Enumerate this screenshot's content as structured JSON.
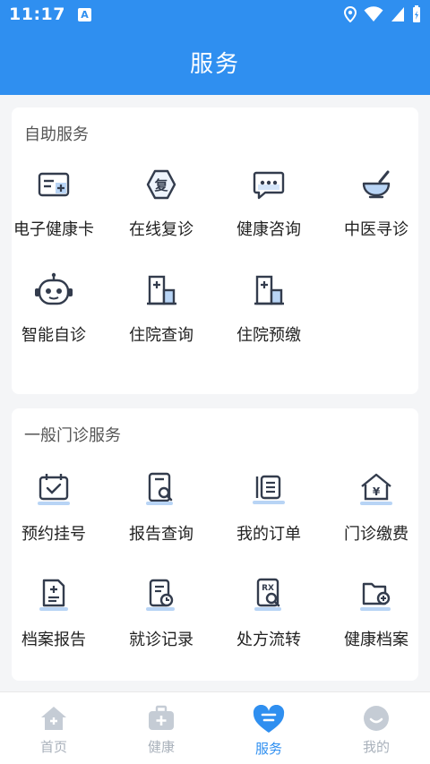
{
  "status_bar": {
    "time": "11:17",
    "notification_badge": "A"
  },
  "header": {
    "title": "服务"
  },
  "sections": [
    {
      "title": "自助服务",
      "items": [
        {
          "label": "电子健康卡",
          "icon": "health-card-icon"
        },
        {
          "label": "在线复诊",
          "icon": "revisit-icon",
          "glyph": "复"
        },
        {
          "label": "健康咨询",
          "icon": "chat-icon"
        },
        {
          "label": "中医寻诊",
          "icon": "mortar-icon"
        },
        {
          "label": "智能自诊",
          "icon": "robot-icon"
        },
        {
          "label": "住院查询",
          "icon": "hospital-icon"
        },
        {
          "label": "住院预缴",
          "icon": "hospital-icon"
        }
      ]
    },
    {
      "title": "一般门诊服务",
      "items": [
        {
          "label": "预约挂号",
          "icon": "calendar-check-icon"
        },
        {
          "label": "报告查询",
          "icon": "report-search-icon"
        },
        {
          "label": "我的订单",
          "icon": "order-icon"
        },
        {
          "label": "门诊缴费",
          "icon": "payment-house-icon",
          "glyph": "¥"
        },
        {
          "label": "档案报告",
          "icon": "file-plus-icon"
        },
        {
          "label": "就诊记录",
          "icon": "record-clock-icon"
        },
        {
          "label": "处方流转",
          "icon": "prescription-search-icon",
          "glyph": "RX"
        },
        {
          "label": "健康档案",
          "icon": "folder-plus-icon"
        }
      ]
    }
  ],
  "tabs": [
    {
      "label": "首页",
      "icon": "home-icon",
      "active": false
    },
    {
      "label": "健康",
      "icon": "medkit-icon",
      "active": false
    },
    {
      "label": "服务",
      "icon": "heart-service-icon",
      "active": true
    },
    {
      "label": "我的",
      "icon": "profile-icon",
      "active": false
    }
  ],
  "colors": {
    "primary": "#2f8ff0",
    "icon_stroke": "#333c4d",
    "icon_accent": "#b8d4f5",
    "tab_inactive": "#c5ccd5"
  }
}
